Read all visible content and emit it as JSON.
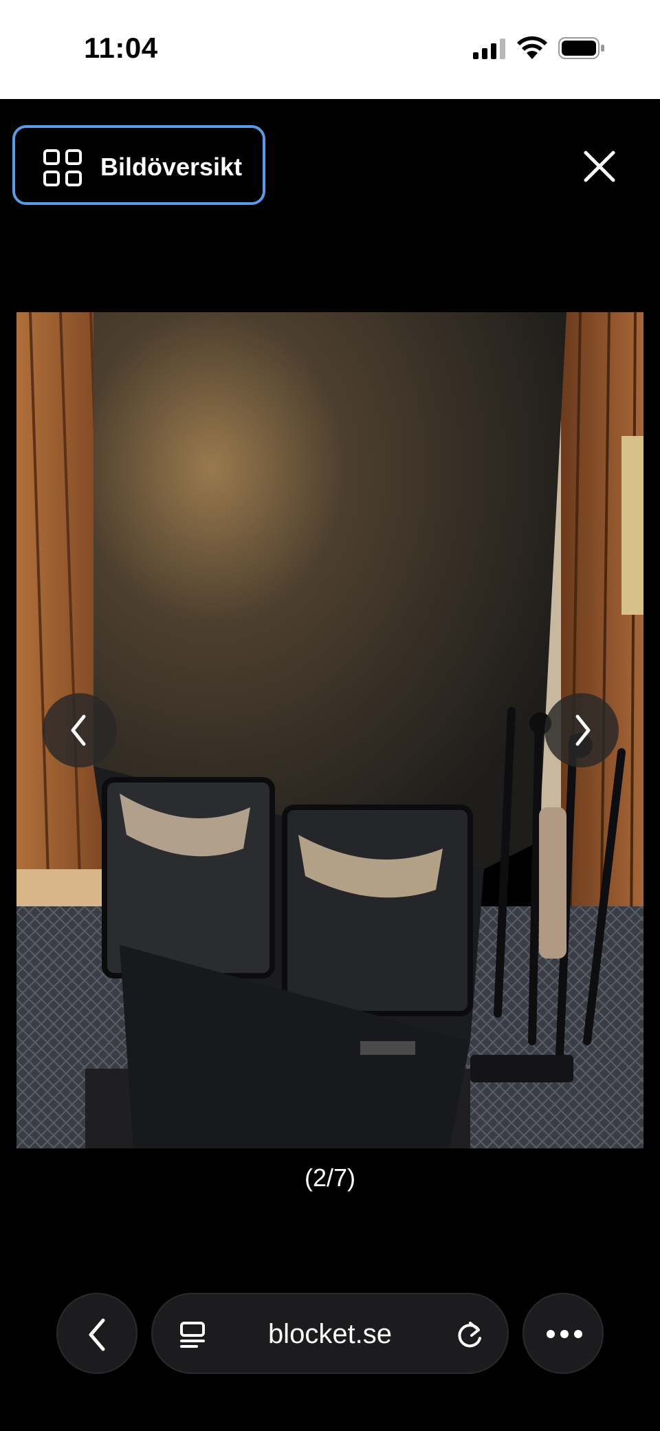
{
  "status_bar": {
    "time": "11:04"
  },
  "toolbar": {
    "overview_label": "Bildöversikt"
  },
  "gallery": {
    "counter": "(2/7)"
  },
  "browser": {
    "url": "blocket.se"
  },
  "icons": {
    "overview": "grid-icon",
    "close": "close-icon",
    "prev": "chevron-left-icon",
    "next": "chevron-right-icon",
    "back": "chevron-left-icon",
    "tabs": "tabs-icon",
    "reload": "reload-icon",
    "more": "more-icon"
  },
  "colors": {
    "accent_border": "#5a9ae6",
    "background": "#000000"
  }
}
